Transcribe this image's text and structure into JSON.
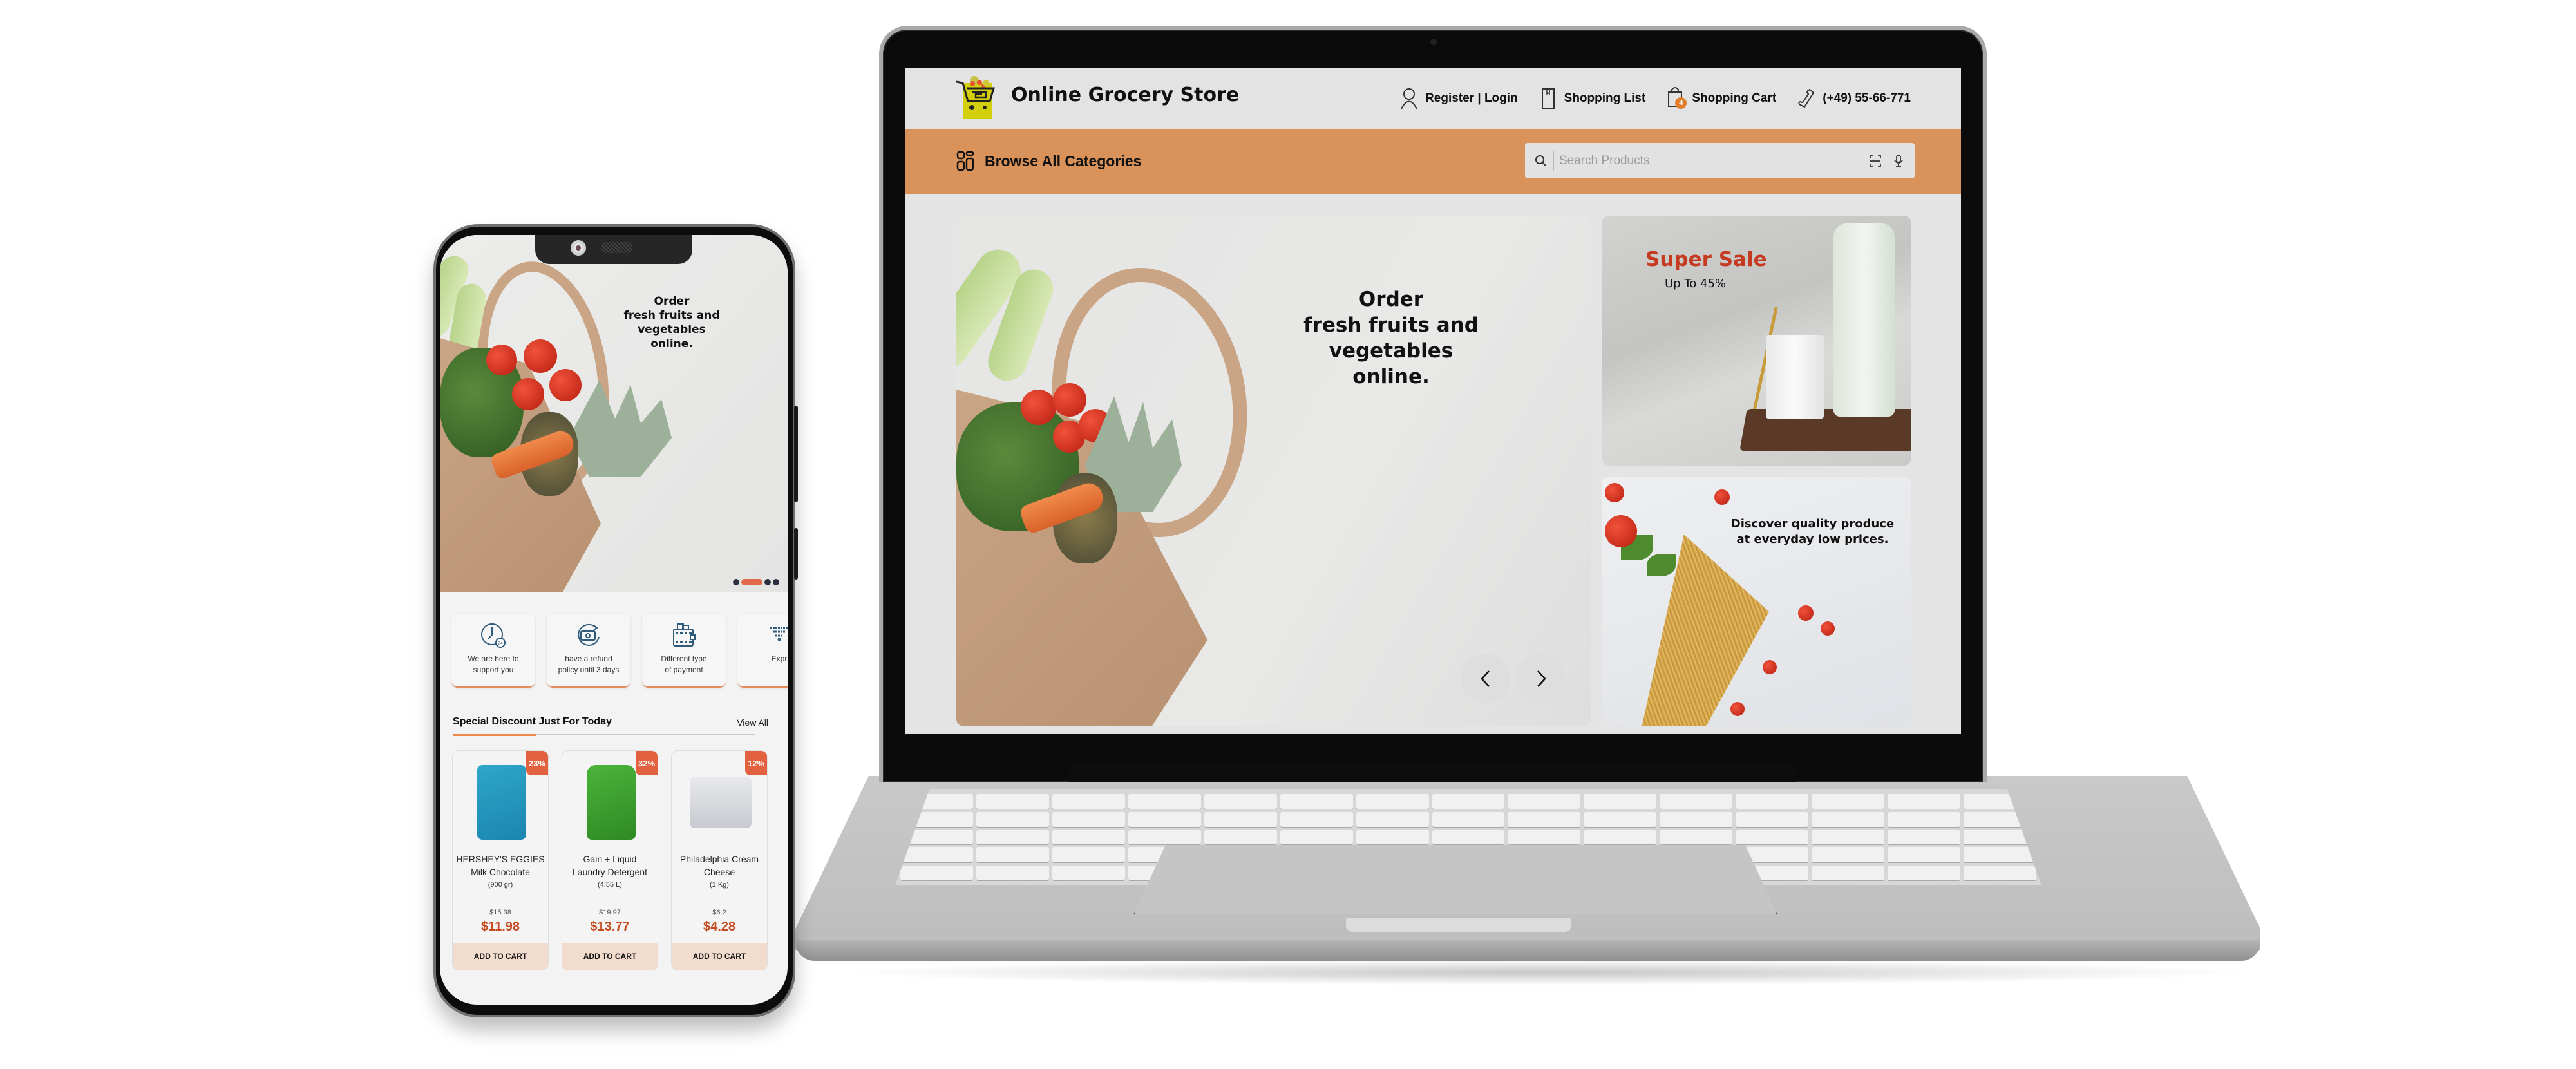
{
  "laptop": {
    "site": {
      "title": "Online Grocery Store",
      "top_links": [
        {
          "icon": "user-icon",
          "label": "Register | Login"
        },
        {
          "icon": "bookmark-list-icon",
          "label": "Shopping List"
        },
        {
          "icon": "shopping-bag-icon",
          "label": "Shopping Cart",
          "badge": "4"
        },
        {
          "icon": "phone-icon",
          "label": "(+49) 55-66-771"
        }
      ],
      "category_bar": {
        "browse_label": "Browse All Categories",
        "search_placeholder": "Search Products",
        "search_value": ""
      },
      "hero": {
        "line1": "Order",
        "line2": "fresh fruits and vegetables",
        "line3": "online.",
        "prev_label": "previous slide",
        "next_label": "next slide"
      },
      "promo_sale": {
        "title": "Super Sale",
        "subtitle": "Up To 45%"
      },
      "promo_pasta": {
        "line1": "Discover quality produce",
        "line2": "at everyday low prices."
      }
    }
  },
  "phone": {
    "hero": {
      "line1": "Order",
      "line2": "fresh fruits and vegetables",
      "line3": "online.",
      "slide_count": 4,
      "active_slide": 2
    },
    "features": [
      {
        "icon": "clock-24-icon",
        "line1": "We are here to",
        "line2": "support you"
      },
      {
        "icon": "refund-money-icon",
        "line1": "have a refund",
        "line2": "policy until 3 days"
      },
      {
        "icon": "wallet-icon",
        "line1": "Different type",
        "line2": "of payment"
      },
      {
        "icon": "express-delivery-icon",
        "line1": "Expr",
        "line2": ""
      }
    ],
    "special_discount": {
      "title": "Special Discount Just For Today",
      "view_all": "View All",
      "products": [
        {
          "name1": "HERSHEY'S EGGIES",
          "name2": "Milk Chocolate",
          "size": "(900 gr)",
          "old_price": "$15.38",
          "new_price": "$11.98",
          "discount": "23%",
          "cta": "ADD TO CART"
        },
        {
          "name1": "Gain + Liquid",
          "name2": "Laundry Detergent",
          "size": "(4.55 L)",
          "old_price": "$19.97",
          "new_price": "$13.77",
          "discount": "32%",
          "cta": "ADD TO CART"
        },
        {
          "name1": "Philadelphia Cream",
          "name2": "Cheese",
          "size": "(1 Kg)",
          "old_price": "$6.2",
          "new_price": "$4.28",
          "discount": "12%",
          "cta": "ADD TO CART"
        }
      ]
    }
  },
  "colors": {
    "accent_orange": "#d99259",
    "sale_red": "#c53b22",
    "price_red": "#c44a1f",
    "badge_orange": "#e2623f",
    "cart_button_bg": "#f2dccd",
    "icon_blue": "#2f5b7c"
  }
}
